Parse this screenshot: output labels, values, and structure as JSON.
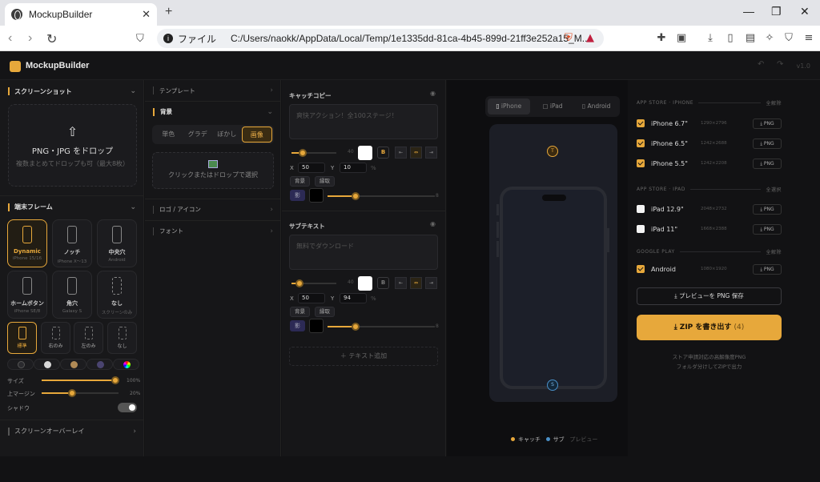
{
  "browser": {
    "tab_title": "MockupBuilder",
    "tab_close": "✕",
    "new_tab": "+",
    "win_min": "—",
    "win_max": "❐",
    "win_close": "✕",
    "back": "‹",
    "forward": "›",
    "reload": "↻",
    "url_prefix": "ファイル",
    "url": "C:/Users/naokk/AppData/Local/Temp/1e1335dd-81ca-4b45-899d-21ff3e252a15_M..."
  },
  "app": {
    "title": "MockupBuilder",
    "version": "v1.0",
    "accent": "#e7a83b"
  },
  "left": {
    "screenshot_header": "スクリーンショット",
    "drop_title": "PNG・JPG をドロップ",
    "drop_sub": "複数まとめてドロップも可（最大8枚）",
    "frame_header": "端末フレーム",
    "frames": [
      {
        "name": "Dynamic",
        "sub": "iPhone 15/16"
      },
      {
        "name": "ノッチ",
        "sub": "iPhone X〜13"
      },
      {
        "name": "中央穴",
        "sub": "Android"
      },
      {
        "name": "ホームボタン",
        "sub": "iPhone SE/8"
      },
      {
        "name": "角穴",
        "sub": "Galaxy S"
      },
      {
        "name": "なし",
        "sub": "スクリーンのみ"
      }
    ],
    "buttons": [
      "標準",
      "右のみ",
      "左のみ",
      "なし"
    ],
    "swatch_colors": [
      "#2a2a2e",
      "#d8d8d8",
      "#b08a56",
      "#4a4470",
      "rainbow"
    ],
    "size_label": "サイズ",
    "size_value": "100%",
    "size_level": 1.0,
    "margin_label": "上マージン",
    "margin_value": "20%",
    "margin_level": 0.4,
    "shadow_label": "シャドウ",
    "shadow_on": true,
    "overlay_header": "スクリーンオーバーレイ"
  },
  "middle": {
    "template_label": "テンプレート",
    "bg_label": "背景",
    "bg_tabs": [
      "単色",
      "グラデ",
      "ぼかし",
      "画像"
    ],
    "bg_selected": "画像",
    "image_drop": "クリックまたはドロップで選択",
    "logo_label": "ロゴ / アイコン",
    "font_label": "フォント"
  },
  "text": {
    "catch_header": "キャッチコピー",
    "catch_placeholder": "爽快アクション！全100ステージ！",
    "catch_x": "50",
    "catch_y": "10",
    "sub_header": "サブテキスト",
    "sub_placeholder": "無料でダウンロード",
    "sub_x": "50",
    "sub_y": "94",
    "x_label": "X",
    "y_label": "Y",
    "pct": "%",
    "bold": "B",
    "chip_bg": "背景",
    "chip_outline": "縁取",
    "shadow_btn": "影",
    "size_mark": "40",
    "shadow_mark": "8",
    "add_text": "＋ テキスト追加"
  },
  "preview": {
    "tabs": [
      "iPhone",
      "iPad",
      "Android"
    ],
    "selected": "iPhone",
    "marker_t": "T",
    "marker_s": "S",
    "legend_catch": "キャッチ",
    "legend_sub": "サブ",
    "legend_preview": "プレビュー"
  },
  "export": {
    "ios_group": "APP STORE · IPHONE",
    "ios_all": "全解除",
    "ios": [
      {
        "name": "iPhone 6.7\"",
        "size": "1290×2796",
        "checked": true
      },
      {
        "name": "iPhone 6.5\"",
        "size": "1242×2688",
        "checked": true
      },
      {
        "name": "iPhone 5.5\"",
        "size": "1242×2208",
        "checked": true
      }
    ],
    "ipad_group": "APP STORE · IPAD",
    "ipad_all": "全選択",
    "ipad": [
      {
        "name": "iPad 12.9\"",
        "size": "2048×2732",
        "checked": false
      },
      {
        "name": "iPad 11\"",
        "size": "1668×2388",
        "checked": false
      }
    ],
    "gp_group": "GOOGLE PLAY",
    "gp_all": "全解除",
    "gp": [
      {
        "name": "Android",
        "size": "1080×1920",
        "checked": true
      }
    ],
    "png_label": "⤓ PNG",
    "save_preview": "⤓ プレビューを PNG 保存",
    "zip_label": "⤓ ZIP を書き出す",
    "zip_count": "(4)",
    "note1": "ストア申請対応の高解像度PNG",
    "note2": "フォルダ分けしてZIPで出力"
  }
}
